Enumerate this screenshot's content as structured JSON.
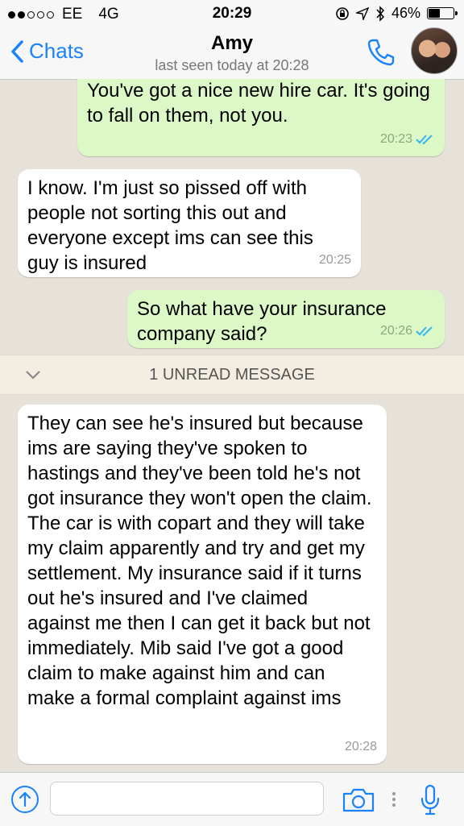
{
  "status_bar": {
    "carrier": "EE",
    "network": "4G",
    "time": "20:29",
    "battery": "46%",
    "battery_level": 0.46
  },
  "header": {
    "back_label": "Chats",
    "contact_name": "Amy",
    "last_seen": "last seen today at 20:28"
  },
  "messages": [
    {
      "direction": "outgoing",
      "text": "Just wait until Friday to speak to him. You've got a nice new hire car. It's going to fall on them, not you.",
      "time": "20:23",
      "status": "read"
    },
    {
      "direction": "incoming",
      "text": "I know. I'm just so pissed off with people not sorting this out and everyone except ims can see this guy is insured",
      "time": "20:25"
    },
    {
      "direction": "outgoing",
      "text": "So what have your insurance company said?",
      "time": "20:26",
      "status": "read"
    },
    {
      "direction": "incoming",
      "text": "They can see he's insured but because ims are saying they've spoken to hastings and they've been told he's not got insurance they won't open the claim. The car is with copart and they will take my claim apparently and try and get my settlement. My insurance said if it turns out he's insured and I've claimed against me then I can get it back but not immediately. Mib said I've got a good claim to make against him and can make a formal complaint against ims",
      "time": "20:28"
    }
  ],
  "unread_banner": "1 UNREAD MESSAGE",
  "input": {
    "placeholder": ""
  },
  "colors": {
    "accent": "#1a82fb",
    "outgoing": "#dcf8c6",
    "incoming": "#ffffff",
    "read_ticks": "#34b7f1"
  }
}
